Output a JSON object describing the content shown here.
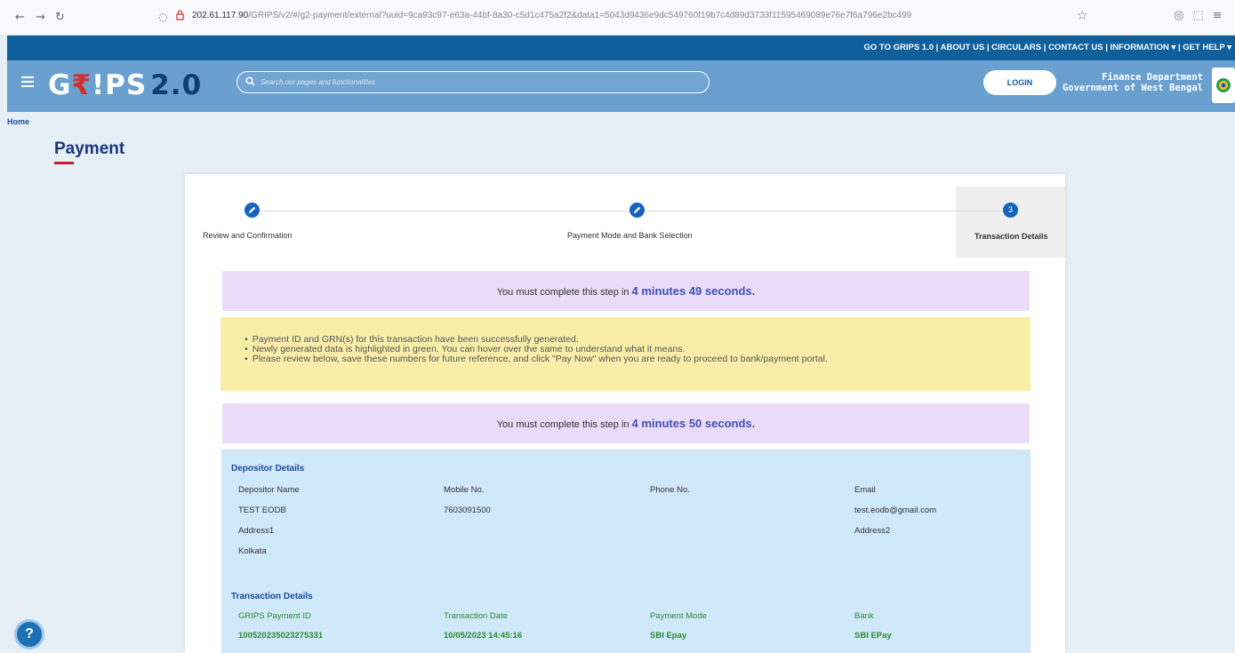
{
  "browser": {
    "url_host": "202.61.117.90",
    "url_path": "/GRIPS/v2/#/g2-payment/external?uuid=9ca93c97-e63a-44bf-8a30-c5d1c475a2f2&data1=5043d9436e9dc549760f19b7c4d89d3733f11595469089e76e7f6a796e2bc499"
  },
  "toplinks": {
    "grips1": "GO TO GRIPS 1.0",
    "about": "ABOUT US",
    "circulars": "CIRCULARS",
    "contact": "CONTACT US",
    "information": "INFORMATION ▾",
    "help": "GET HELP ▾"
  },
  "header": {
    "logo_g": "G",
    "logo_rupee": "₹",
    "logo_ips": "!PS",
    "logo_version": "2.0",
    "search_placeholder": "Search our pages and functionalities",
    "login_label": "LOGIN",
    "dept_line1": "Finance Department",
    "dept_line2": "Government of West Bengal"
  },
  "breadcrumb": "Home",
  "page_title": "Payment",
  "steps": [
    {
      "label": "Review and Confirmation",
      "icon": "pencil-icon",
      "state": "done"
    },
    {
      "label": "Payment Mode and Bank Selection",
      "icon": "pencil-icon",
      "state": "done"
    },
    {
      "label": "Transaction Details",
      "number": "3",
      "state": "active"
    }
  ],
  "timer1": {
    "label": "You must complete this step in",
    "time": "4 minutes 49 seconds."
  },
  "notice": [
    "Payment ID and GRN(s) for this transaction have been successfully generated.",
    "Newly generated data is highlighted in green. You can hover over the same to understand what it means.",
    "Please review below, save these numbers for future reference, and click \"Pay Now\" when you are ready to proceed to bank/payment portal."
  ],
  "timer2": {
    "label": "You must complete this step in",
    "time": "4 minutes 50 seconds."
  },
  "depositor": {
    "title": "Depositor Details",
    "name_label": "Depositor Name",
    "name_value": "TEST EODB",
    "mobile_label": "Mobile No.",
    "mobile_value": "7603091500",
    "phone_label": "Phone No.",
    "email_label": "Email",
    "email_value": "test.eodb@gmail.com",
    "address1_label": "Address1",
    "address1_value": "Kolkata",
    "address2_label": "Address2"
  },
  "transaction": {
    "title": "Transaction Details",
    "payment_id_label": "GRIPS Payment ID",
    "payment_id_value": "100520235023275331",
    "date_label": "Transaction Date",
    "date_value": "10/05/2023 14:45:16",
    "mode_label": "Payment Mode",
    "mode_value": "SBI Epay",
    "bank_label": "Bank",
    "bank_value": "SBI EPay"
  },
  "help_label": "?",
  "colors": {
    "topbar": "#0e5f9c",
    "header": "#6aa0cf",
    "timer_bg": "#eadcf8",
    "notice_bg": "#f9eea7",
    "details_bg": "#cfe8fa",
    "accent_green": "#2e8b2e",
    "accent_blue": "#1565c0"
  }
}
